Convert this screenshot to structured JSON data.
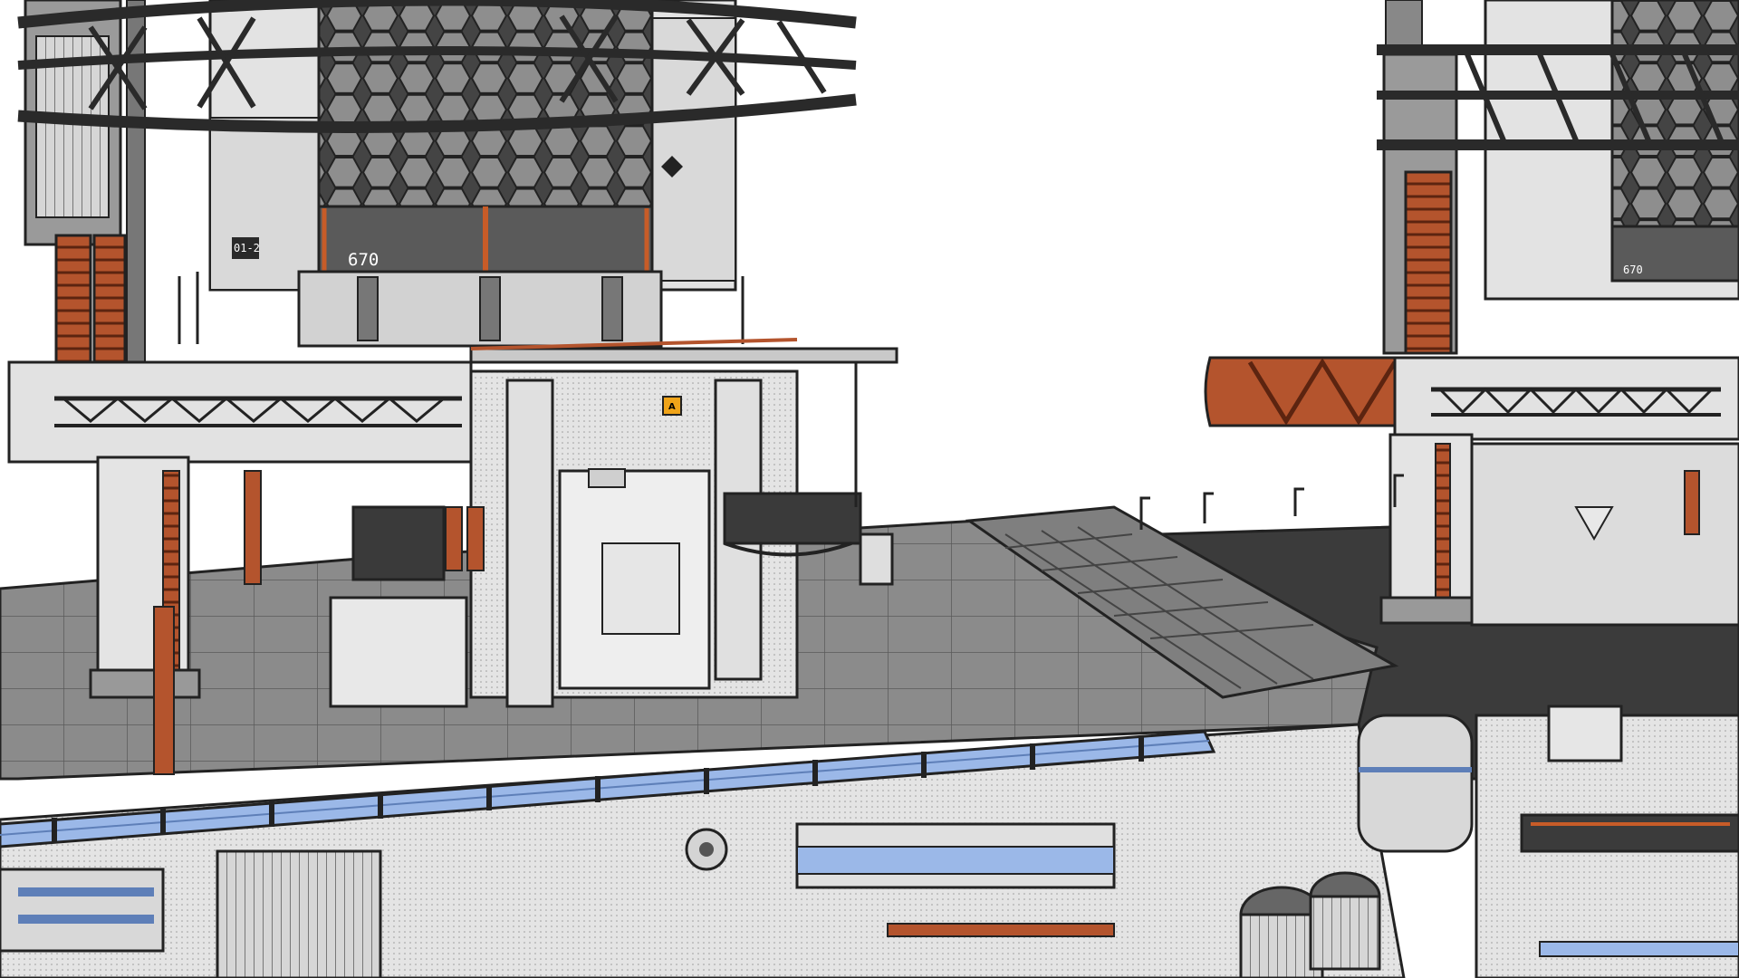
{
  "scene": {
    "left_tower_marking": "670",
    "right_tower_marking": "670",
    "module_tag": "01-2",
    "badge_letter": "A"
  },
  "colors": {
    "background": "#ffffff",
    "metal_light": "#e6e6e6",
    "metal_mid": "#b9b9b9",
    "metal_dark": "#4d4d4d",
    "deck": "#8a8a8a",
    "deck_dark": "#3b3b3b",
    "rust": "#b4542d",
    "glass": "#9bb8e8",
    "line": "#1c1c1c",
    "badge": "#f0a419"
  }
}
